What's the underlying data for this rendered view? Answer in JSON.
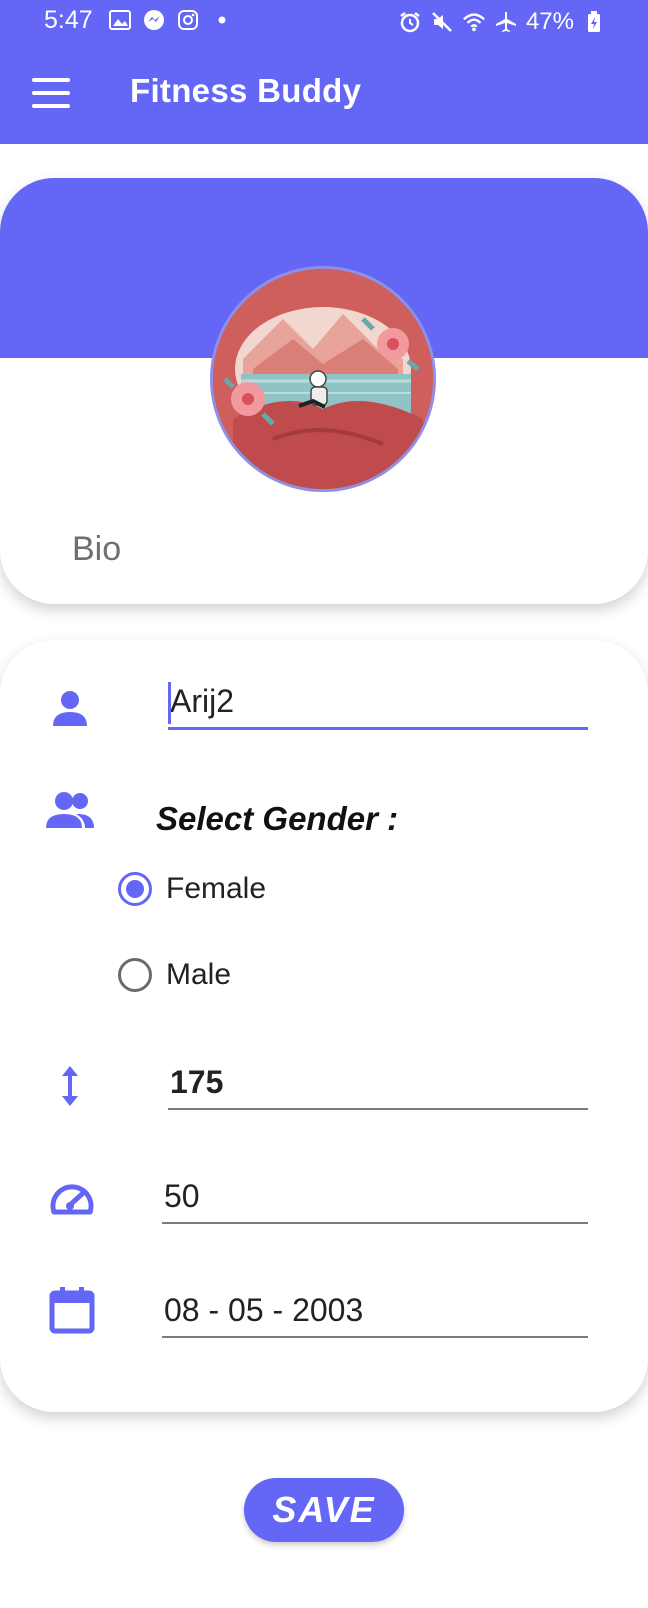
{
  "status_bar": {
    "time": "5:47",
    "battery": "47%",
    "left_icons": [
      "gallery-icon",
      "messenger-icon",
      "instagram-icon",
      "dot-icon"
    ],
    "right_icons": [
      "alarm-icon",
      "mute-icon",
      "wifi-icon",
      "airplane-icon",
      "battery-icon"
    ]
  },
  "app_bar": {
    "title": "Fitness Buddy",
    "menu_icon": "hamburger-menu-icon"
  },
  "profile": {
    "bio_placeholder": "Bio"
  },
  "form": {
    "name_value": "Arij2",
    "gender_label": "Select Gender :",
    "gender_options": [
      {
        "label": "Female",
        "checked": true
      },
      {
        "label": "Male",
        "checked": false
      }
    ],
    "height_value": "175",
    "weight_value": "50",
    "birthdate_value": "08 - 05 - 2003"
  },
  "actions": {
    "save_label": "SAVE"
  },
  "colors": {
    "accent": "#6466f6",
    "background": "#ffffff"
  }
}
